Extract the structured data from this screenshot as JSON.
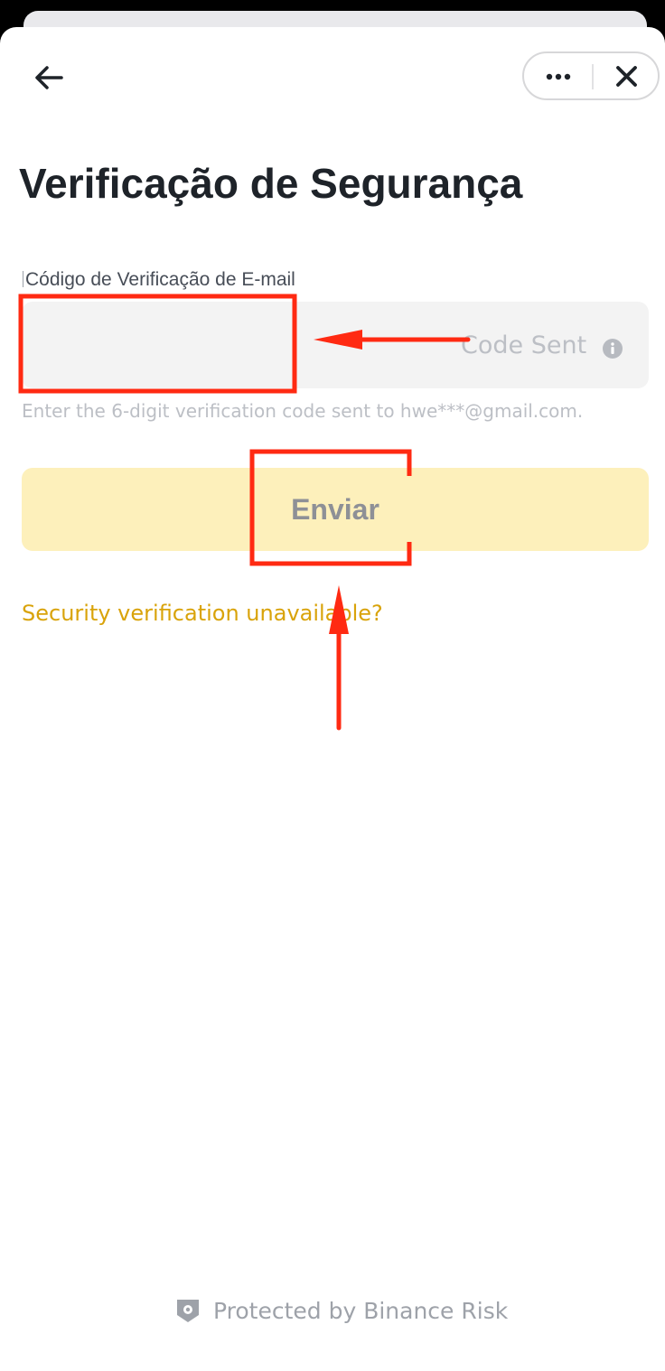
{
  "header": {
    "back_icon": "arrow-left-icon",
    "more_icon": "more-horizontal-icon",
    "close_icon": "close-icon"
  },
  "page": {
    "title": "Verificação de Segurança"
  },
  "form": {
    "field_label": "Código de Verificação de E-mail",
    "code_value": "",
    "code_status": "Code Sent",
    "info_icon": "info-icon",
    "helper_text": "Enter the 6-digit verification code sent to hwe***@gmail.com.",
    "submit_label": "Enviar"
  },
  "links": {
    "unavailable": "Security verification unavailable?"
  },
  "footer": {
    "icon": "shield-icon",
    "text": "Protected by Binance Risk"
  },
  "colors": {
    "title": "#1e2329",
    "input_bg": "#f3f3f3",
    "button_bg": "#fdf0bb",
    "button_text": "#8e9096",
    "link": "#d9a30a",
    "muted": "#bcbfc5",
    "annotation": "#ff2a12"
  },
  "annotations": {
    "highlight_boxes": [
      "code-input-highlight",
      "submit-button-highlight"
    ],
    "arrows": [
      "arrow-to-code-input",
      "arrow-to-submit-button"
    ]
  }
}
